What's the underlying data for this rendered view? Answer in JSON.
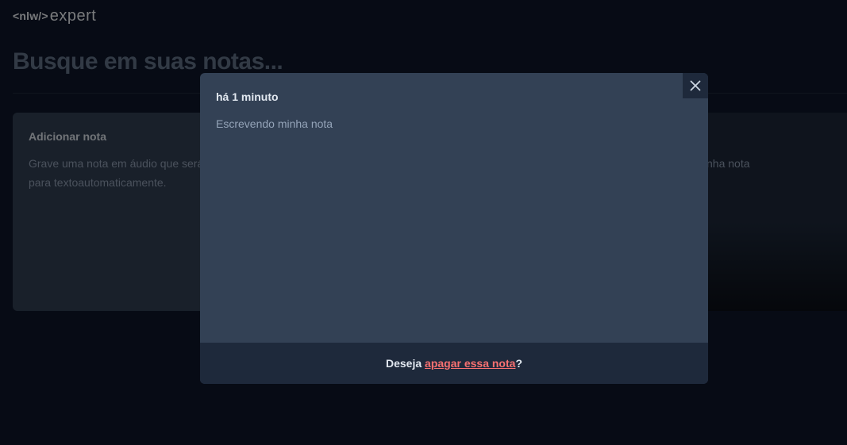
{
  "app": {
    "logo_tag": "<nlw/>",
    "logo_word": "expert"
  },
  "search": {
    "placeholder": "Busque em suas notas..."
  },
  "cards": {
    "add": {
      "title": "Adicionar nota",
      "description": "Grave uma nota em áudio que será convertida para textoautomaticamente."
    },
    "note_partial_text": "nha nota"
  },
  "modal": {
    "date": "há 1 minuto",
    "content": "Escrevendo minha nota",
    "footer_prefix": "Deseja ",
    "footer_link": "apagar essa nota",
    "footer_suffix": "?",
    "close_icon": "x-icon"
  },
  "colors": {
    "background": "#0f172a",
    "card": "#334155",
    "modal": "#334155",
    "footer": "#1e293b",
    "danger": "#f87171"
  }
}
